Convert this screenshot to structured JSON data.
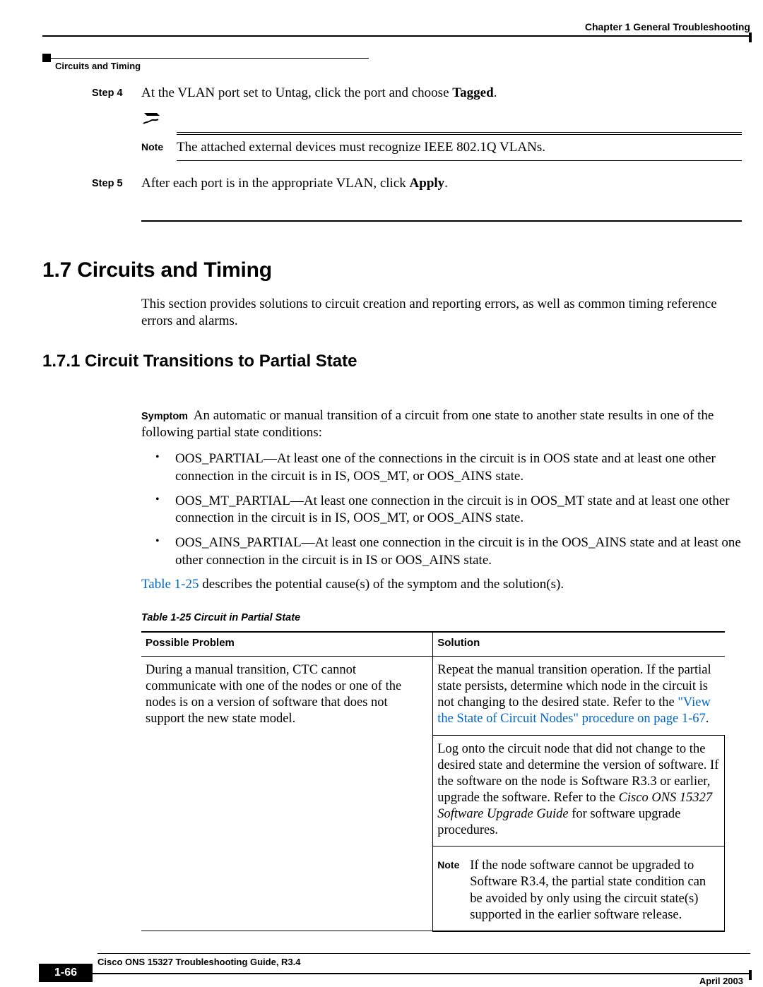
{
  "header": {
    "chapter_ref": "Chapter 1    General Troubleshooting",
    "section_label": "Circuits and Timing"
  },
  "steps": [
    {
      "label": "Step 4",
      "pre": "At the VLAN port set to Untag, click the port and choose ",
      "bold": "Tagged",
      "post": "."
    },
    {
      "label": "Step 5",
      "pre": "After each port is in the appropriate VLAN, click ",
      "bold": "Apply",
      "post": "."
    }
  ],
  "note": {
    "label": "Note",
    "text": "The attached external devices must recognize IEEE 802.1Q VLANs."
  },
  "h2": "1.7  Circuits and Timing",
  "h2_para": "This section provides solutions to circuit creation and reporting errors, as well as common timing reference errors and alarms.",
  "h3": "1.7.1  Circuit Transitions to Partial State",
  "symptom": {
    "label": "Symptom",
    "text": "An automatic or manual transition of a circuit from one state to another state results in one of the following partial state conditions:"
  },
  "bullets": [
    "OOS_PARTIAL—At least one of the connections in the circuit is in OOS state and at least one other connection in the circuit is in IS, OOS_MT, or OOS_AINS state.",
    "OOS_MT_PARTIAL—At least one connection in the circuit is in OOS_MT state and at least one other connection in the circuit is in IS, OOS_MT, or OOS_AINS state.",
    "OOS_AINS_PARTIAL—At least one connection in the circuit is in the OOS_AINS state and at least one other connection in the circuit is in IS or OOS_AINS state."
  ],
  "table_ref_link": "Table 1-25",
  "table_ref_text": " describes the potential cause(s) of the symptom and the solution(s).",
  "table": {
    "caption": "Table 1-25   Circuit in Partial State",
    "col1": "Possible Problem",
    "col2": "Solution",
    "problem": "During a manual transition, CTC cannot communicate with one of the nodes or one of the nodes is on a version of software that does not support the new state model.",
    "sol1_pre": "Repeat the manual transition operation. If the partial state persists, determine which node in the circuit is not changing to the desired state. Refer to the ",
    "sol1_link": "\"View the State of Circuit Nodes\" procedure on page 1-67",
    "sol1_post": ".",
    "sol2_pre": "Log onto the circuit node that did not change to the desired state and determine the version of software. If the software on the node is Software R3.3 or earlier, upgrade the software. Refer to the ",
    "sol2_ital": "Cisco ONS 15327 Software Upgrade Guide",
    "sol2_post": " for software upgrade procedures.",
    "sol_note_label": "Note",
    "sol_note": "If the node software cannot be upgraded to Software R3.4, the partial state condition can be avoided by only using the circuit state(s) supported in the earlier software release."
  },
  "footer": {
    "doc_title": "Cisco ONS 15327 Troubleshooting Guide, R3.4",
    "page": "1-66",
    "date": "April 2003"
  }
}
